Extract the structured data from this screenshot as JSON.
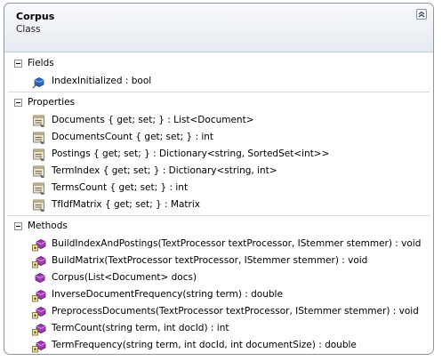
{
  "header": {
    "title": "Corpus",
    "stereotype": "Class"
  },
  "fields": {
    "title": "Fields",
    "items": [
      {
        "text": "IndexInitialized : bool",
        "icon": "field-icon"
      }
    ]
  },
  "properties": {
    "title": "Properties",
    "items": [
      {
        "text": "Documents { get; set; } : List<Document>",
        "icon": "property-icon"
      },
      {
        "text": "DocumentsCount { get; set; } : int",
        "icon": "property-icon"
      },
      {
        "text": "Postings { get; set; } : Dictionary<string, SortedSet<int>>",
        "icon": "property-icon"
      },
      {
        "text": "TermIndex { get; set; } : Dictionary<string, int>",
        "icon": "property-icon"
      },
      {
        "text": "TermsCount { get; set; } : int",
        "icon": "property-icon"
      },
      {
        "text": "TfIdfMatrix { get; set; } : Matrix",
        "icon": "property-icon"
      }
    ]
  },
  "methods": {
    "title": "Methods",
    "items": [
      {
        "text": "BuildIndexAndPostings(TextProcessor textProcessor, IStemmer stemmer) : void",
        "icon": "method-icon"
      },
      {
        "text": "BuildMatrix(TextProcessor textProcessor, IStemmer stemmer) : void",
        "icon": "method-icon"
      },
      {
        "text": "Corpus(List<Document> docs)",
        "icon": "constructor-icon"
      },
      {
        "text": "InverseDocumentFrequency(string term) : double",
        "icon": "method-icon"
      },
      {
        "text": "PreprocessDocuments(TextProcessor textProcessor, IStemmer stemmer) : void",
        "icon": "method-icon"
      },
      {
        "text": "TermCount(string term, int docId) : int",
        "icon": "method-icon"
      },
      {
        "text": "TermFrequency(string term, int docId, int documentSize) : double",
        "icon": "method-icon"
      }
    ]
  }
}
